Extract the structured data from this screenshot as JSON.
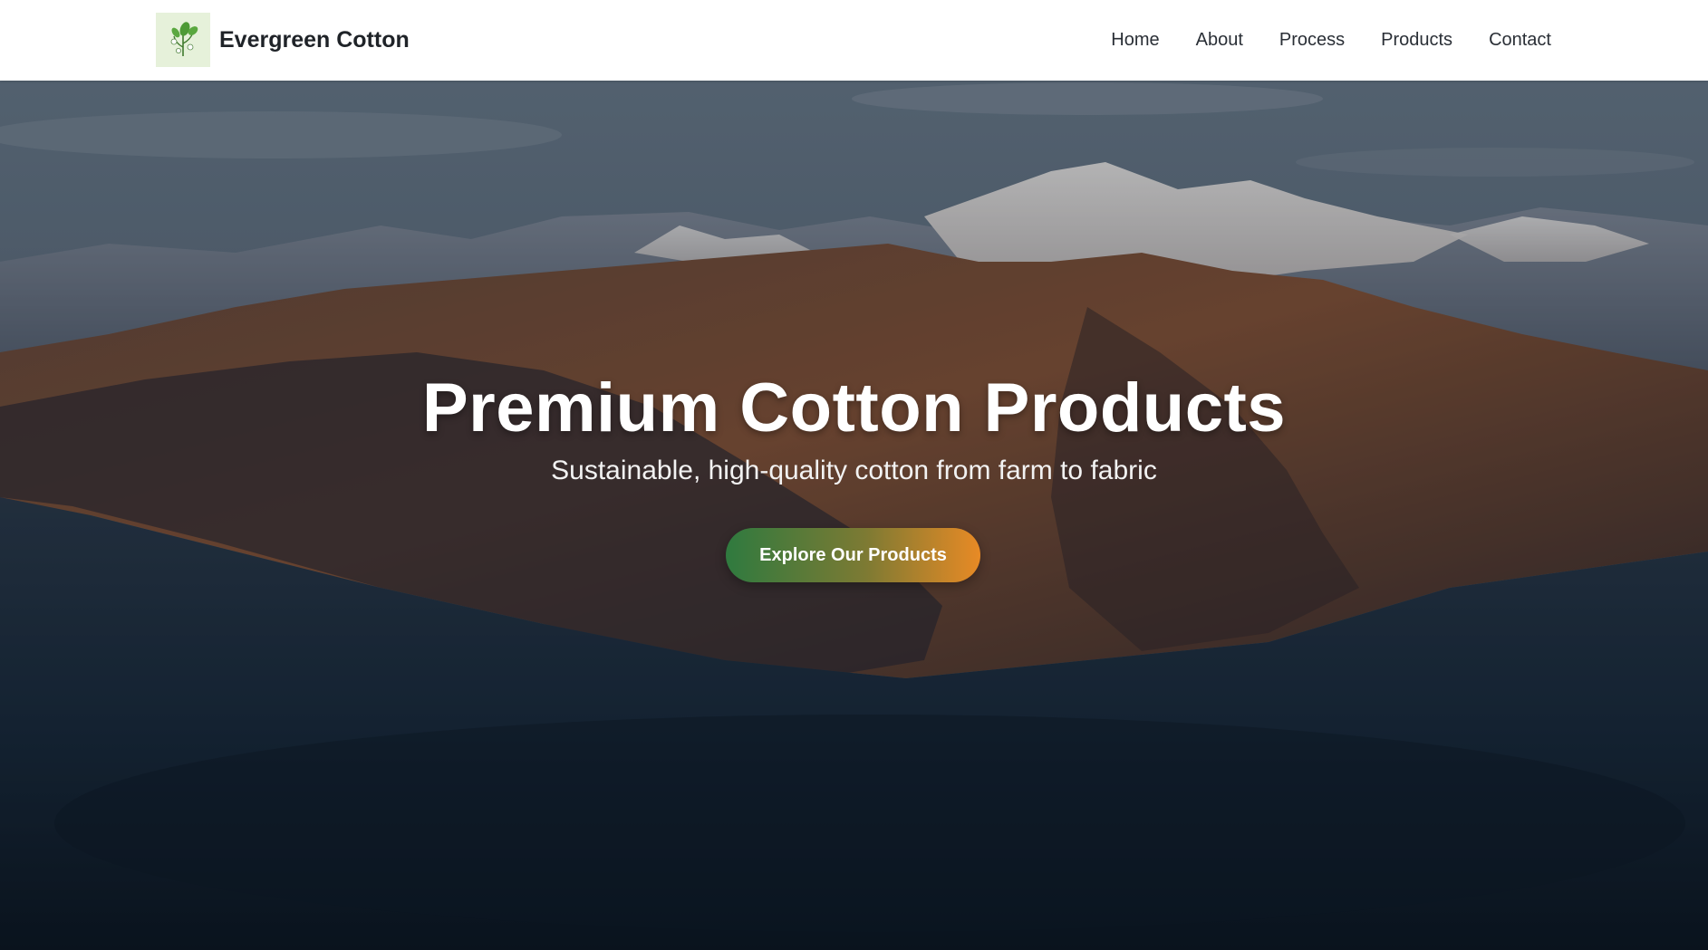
{
  "brand": {
    "name": "Evergreen Cotton",
    "logo_icon": "cotton-plant-icon"
  },
  "nav": {
    "items": [
      {
        "label": "Home"
      },
      {
        "label": "About"
      },
      {
        "label": "Process"
      },
      {
        "label": "Products"
      },
      {
        "label": "Contact"
      }
    ]
  },
  "hero": {
    "title": "Premium Cotton Products",
    "subtitle": "Sustainable, high-quality cotton from farm to fabric",
    "cta_label": "Explore Our Products",
    "background_image": "mountain-lake-landscape"
  },
  "colors": {
    "header_bg": "#ffffff",
    "cta_gradient_start": "#2f7a3f",
    "cta_gradient_end": "#e88a25",
    "logo_bg": "#e6f1da"
  }
}
